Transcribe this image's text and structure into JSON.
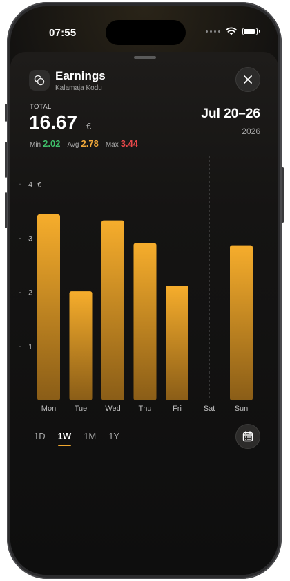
{
  "status": {
    "time": "07:55"
  },
  "header": {
    "icon": "coins-icon",
    "title": "Earnings",
    "subtitle": "Kalamaja Kodu",
    "close_icon": "close-icon"
  },
  "summary": {
    "total_label": "TOTAL",
    "total_value": "16.67",
    "currency": "€",
    "date_range": "Jul 20–26",
    "year": "2026",
    "min_label": "Min",
    "min_value": "2.02",
    "avg_label": "Avg",
    "avg_value": "2.78",
    "max_label": "Max",
    "max_value": "3.44"
  },
  "colors": {
    "accent": "#F2A93A",
    "min": "#3FBF6A",
    "avg": "#F2A93A",
    "max": "#E8484A"
  },
  "chart_data": {
    "type": "bar",
    "categories": [
      "Mon",
      "Tue",
      "Wed",
      "Thu",
      "Fri",
      "Sat",
      "Sun"
    ],
    "values": [
      3.44,
      2.02,
      3.33,
      2.91,
      2.12,
      null,
      2.87
    ],
    "y_ticks": [
      "1",
      "2",
      "3",
      "4"
    ],
    "ylabel_unit": "€",
    "ylim": [
      0,
      4.4
    ],
    "highlight_category": "Sat"
  },
  "ranges": [
    "1D",
    "1W",
    "1M",
    "1Y"
  ],
  "active_range": "1W",
  "calendar_icon": "calendar-icon"
}
